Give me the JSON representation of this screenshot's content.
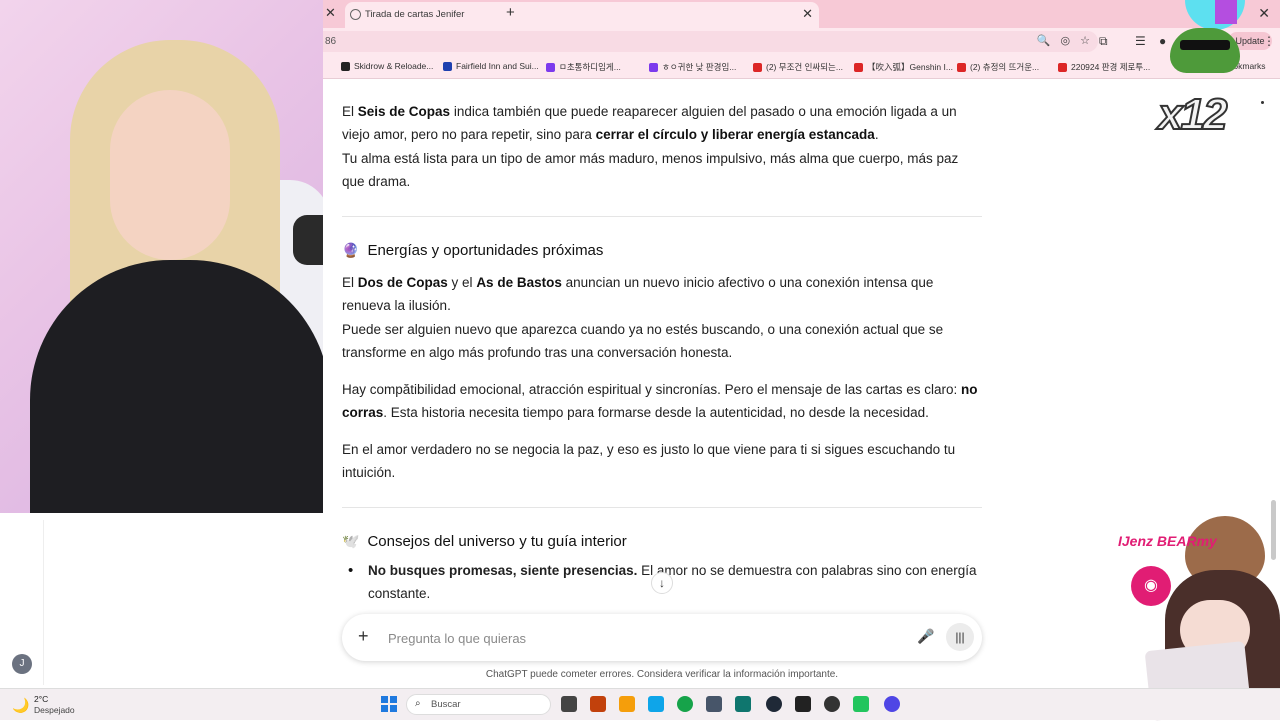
{
  "browser": {
    "tab_title": "Tirada de cartas Jenifer",
    "new_tab": "+",
    "url_fragment": "86",
    "update_label": "Update",
    "bookmarks": [
      "Skidrow & Reloade...",
      "Fairfield Inn and Sui...",
      "ㅁ초통하디임게...",
      "ㅎㅇ귀한 낮 판경임...",
      "(2) 무조건 인싸되는...",
      "【吹入弧】Genshin I...",
      "(2) 츄정의 뜨거운...",
      "220924 판경 제로투...",
      "Bookmarks"
    ],
    "bookmark_colors": [
      "#222222",
      "#1e40af",
      "#7c3aed",
      "#7c3aed",
      "#dc2626",
      "#dc2626",
      "#dc2626",
      "#dc2626",
      "#666666"
    ]
  },
  "chat": {
    "p1_pre": "El ",
    "p1_b1": "Seis de Copas",
    "p1_mid": " indica también que puede reaparecer alguien del pasado o una emoción ligada a un viejo amor, pero no para repetir, sino para ",
    "p1_b2": "cerrar el círculo y liberar energía estancada",
    "p1_end": ".",
    "p2": "Tu alma está lista para un tipo de amor más maduro, menos impulsivo, más alma que cuerpo, más paz que drama.",
    "h1_icon": "🔮",
    "h1": "Energías y oportunidades próximas",
    "p3_pre": "El ",
    "p3_b1": "Dos de Copas",
    "p3_mid": " y el ",
    "p3_b2": "As de Bastos",
    "p3_end": " anuncian un nuevo inicio afectivo o una conexión intensa que renueva la ilusión.",
    "p4": "Puede ser alguien nuevo que aparezca cuando ya no estés buscando, o una conexión actual que se transforme en algo más profundo tras una conversación honesta.",
    "p5_pre": "Hay compătibilidad emocional, atracción espiritual y sincronías. Pero el mensaje de las cartas es claro: ",
    "p5_b": "no corras",
    "p5_end": ". Esta historia necesita tiempo para formarse desde la autenticidad, no desde la necesidad.",
    "p6": "En el amor verdadero no se negocia la paz, y eso es justo lo que viene para ti si sigues escuchando tu intuición.",
    "h2_icon": "🕊️",
    "h2": "Consejos del universo y tu guía interior",
    "b1_b": "No busques promesas, siente presencias.",
    "b1_text": " El amor no se demuestra con palabras sino con energía constante.",
    "scroll_down": "↓",
    "composer_placeholder": "Pregunta lo que quieras",
    "disclaimer": "ChatGPT puede cometer errores. Considera verificar la información importante.",
    "user_initial": "J"
  },
  "overlay": {
    "combo": "x12",
    "brand": "IJenz BEARmy"
  },
  "taskbar": {
    "temp": "2°C",
    "weather": "Despejado",
    "search": "Buscar",
    "app_colors": [
      "#444444",
      "#c2410c",
      "#f59e0b",
      "#0ea5e9",
      "#16a34a",
      "#475569",
      "#0f766e",
      "#1f2937",
      "#222222",
      "#22c55e",
      "#4f46e5"
    ]
  }
}
